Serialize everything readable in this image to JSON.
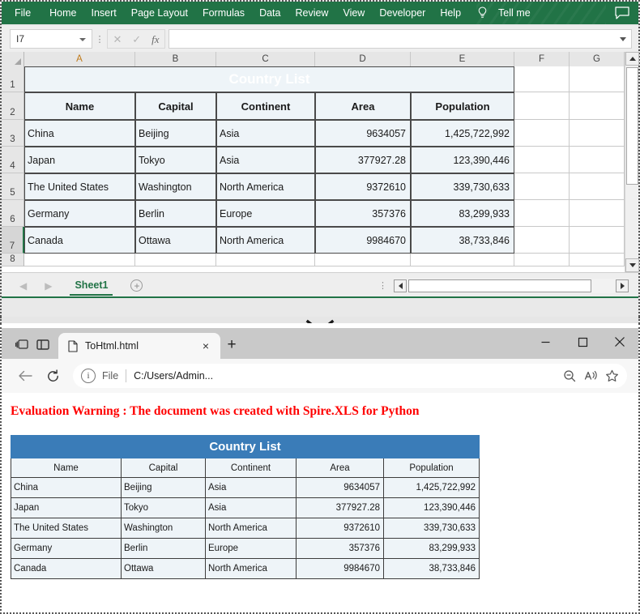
{
  "excel": {
    "ribbon_tabs": [
      "File",
      "Home",
      "Insert",
      "Page Layout",
      "Formulas",
      "Data",
      "Review",
      "View",
      "Developer",
      "Help"
    ],
    "tell_me": "Tell me",
    "bulb_icon": "lightbulb-icon",
    "comment_icon": "comment-icon",
    "name_box_value": "I7",
    "formula_value": "",
    "cancel_icon": "cancel-icon",
    "confirm_icon": "confirm-icon",
    "function_icon": "fx-icon",
    "columns": [
      "A",
      "B",
      "C",
      "D",
      "E",
      "F",
      "G"
    ],
    "active_column": "A",
    "row_numbers": [
      "1",
      "2",
      "3",
      "4",
      "5",
      "6",
      "7",
      "8"
    ],
    "selected_row": "7",
    "title": "Country List",
    "headers": [
      "Name",
      "Capital",
      "Continent",
      "Area",
      "Population"
    ],
    "rows": [
      [
        "China",
        "Beijing",
        "Asia",
        "9634057",
        "1,425,722,992"
      ],
      [
        "Japan",
        "Tokyo",
        "Asia",
        "377927.28",
        "123,390,446"
      ],
      [
        "The United States",
        "Washington",
        "North America",
        "9372610",
        "339,730,633"
      ],
      [
        "Germany",
        "Berlin",
        "Europe",
        "357376",
        "83,299,933"
      ],
      [
        "Canada",
        "Ottawa",
        "North America",
        "9984670",
        "38,733,846"
      ]
    ],
    "sheet_tab": "Sheet1",
    "add_sheet_label": "+",
    "prev_sheet_icon": "chevron-left-icon",
    "next_sheet_icon": "chevron-right-icon",
    "accent_green": "#217346",
    "title_blue": "#3a7cb8",
    "cell_fill": "#eef4f8"
  },
  "divider": {
    "icon": "chevron-down-icon"
  },
  "browser": {
    "tab_actions_icon": "tab-actions-icon",
    "split_screen_icon": "split-screen-icon",
    "tab_title": "ToHtml.html",
    "tab_doc_icon": "document-icon",
    "tab_close_label": "×",
    "new_tab_label": "+",
    "minimize_label": "—",
    "maximize_label": "☐",
    "close_label": "×",
    "back_icon": "back-arrow-icon",
    "refresh_icon": "refresh-icon",
    "info_icon": "i",
    "file_label": "File",
    "url": "C:/Users/Admin...",
    "zoom_icon": "zoom-out-icon",
    "read_aloud_icon": "read-aloud-icon",
    "favorite_icon": "star-icon"
  },
  "page_content": {
    "warning": "Evaluation Warning : The document was created with  Spire.XLS for Python",
    "warning_color": "#ff0000",
    "title": "Country List",
    "headers": [
      "Name",
      "Capital",
      "Continent",
      "Area",
      "Population"
    ],
    "rows": [
      [
        "China",
        "Beijing",
        "Asia",
        "9634057",
        "1,425,722,992"
      ],
      [
        "Japan",
        "Tokyo",
        "Asia",
        "377927.28",
        "123,390,446"
      ],
      [
        "The United States",
        "Washington",
        "North America",
        "9372610",
        "339,730,633"
      ],
      [
        "Germany",
        "Berlin",
        "Europe",
        "357376",
        "83,299,933"
      ],
      [
        "Canada",
        "Ottawa",
        "North America",
        "9984670",
        "38,733,846"
      ]
    ]
  }
}
